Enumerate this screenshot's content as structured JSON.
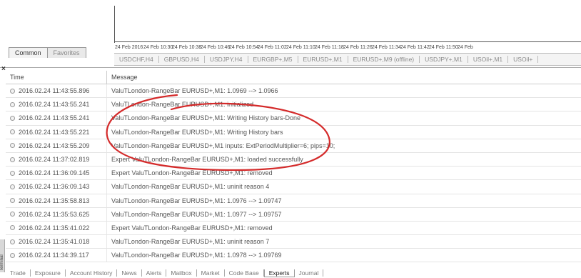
{
  "chart": {
    "time_labels": [
      "24 Feb 2016",
      "24 Feb 10:30",
      "24 Feb 10:38",
      "24 Feb 10:46",
      "24 Feb 10:54",
      "24 Feb 11:02",
      "24 Feb 11:10",
      "24 Feb 11:18",
      "24 Feb 11:26",
      "24 Feb 11:34",
      "24 Feb 11:42",
      "24 Feb 11:50",
      "24 Feb"
    ]
  },
  "navigator": {
    "tabs": [
      "Common",
      "Favorites"
    ]
  },
  "symbol_tabs": [
    "USDCHF,H4",
    "GBPUSD,H4",
    "USDJPY,H4",
    "EURGBP+,M5",
    "EURUSD+,M1",
    "EURUSD+,M9 (offline)",
    "USDJPY+,M1",
    "USOil+,M1",
    "USOil+"
  ],
  "terminal": {
    "close_glyph": "×",
    "side_label": "Terminal",
    "columns": {
      "time": "Time",
      "message": "Message"
    },
    "rows": [
      {
        "time": "2016.02.24 11:43:55.896",
        "message": "ValuTLondon-RangeBar EURUSD+,M1: 1.0969 --> 1.0966"
      },
      {
        "time": "2016.02.24 11:43:55.241",
        "message": "ValuTLondon-RangeBar EURUSD+,M1: initialized"
      },
      {
        "time": "2016.02.24 11:43:55.241",
        "message": "ValuTLondon-RangeBar EURUSD+,M1: Writing History bars-Done"
      },
      {
        "time": "2016.02.24 11:43:55.221",
        "message": "ValuTLondon-RangeBar EURUSD+,M1: Writing History bars"
      },
      {
        "time": "2016.02.24 11:43:55.209",
        "message": "ValuTLondon-RangeBar EURUSD+,M1 inputs: ExtPeriodMultiplier=6; pips=10;"
      },
      {
        "time": "2016.02.24 11:37:02.819",
        "message": "Expert ValuTLondon-RangeBar EURUSD+,M1: loaded successfully"
      },
      {
        "time": "2016.02.24 11:36:09.145",
        "message": "Expert ValuTLondon-RangeBar EURUSD+,M1: removed"
      },
      {
        "time": "2016.02.24 11:36:09.143",
        "message": "ValuTLondon-RangeBar EURUSD+,M1: uninit reason 4"
      },
      {
        "time": "2016.02.24 11:35:58.813",
        "message": "ValuTLondon-RangeBar EURUSD+,M1: 1.0976 --> 1.09747"
      },
      {
        "time": "2016.02.24 11:35:53.625",
        "message": "ValuTLondon-RangeBar EURUSD+,M1: 1.0977 --> 1.09757"
      },
      {
        "time": "2016.02.24 11:35:41.022",
        "message": "Expert ValuTLondon-RangeBar EURUSD+,M1: removed"
      },
      {
        "time": "2016.02.24 11:35:41.018",
        "message": "ValuTLondon-RangeBar EURUSD+,M1: uninit reason 7"
      },
      {
        "time": "2016.02.24 11:34:39.117",
        "message": "ValuTLondon-RangeBar EURUSD+,M1: 1.0978 --> 1.09769"
      }
    ],
    "bottom_tabs": [
      "Trade",
      "Exposure",
      "Account History",
      "News",
      "Alerts",
      "Mailbox",
      "Market",
      "Code Base",
      "Experts",
      "Journal"
    ],
    "active_tab": "Experts"
  },
  "colors": {
    "annotation": "#d42a2a"
  }
}
